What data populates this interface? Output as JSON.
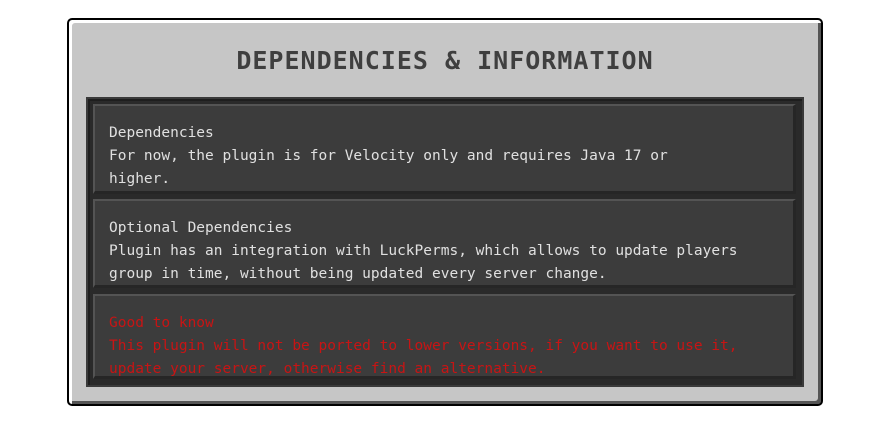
{
  "panel": {
    "title": "DEPENDENCIES & INFORMATION",
    "cards": [
      {
        "heading": "Dependencies",
        "body": "For now, the plugin is for Velocity only and requires Java 17 or\nhigher.",
        "color": "#e0e0e0"
      },
      {
        "heading": "Optional Dependencies",
        "body": "Plugin has an integration with LuckPerms, which allows to update players\ngroup in time, without being updated every server change.",
        "color": "#e0e0e0"
      },
      {
        "heading": "Good to know",
        "body": "This plugin will not be ported to lower versions, if you want to use it,\nupdate your server, otherwise find an alternative.",
        "color": "#c81414"
      }
    ]
  }
}
